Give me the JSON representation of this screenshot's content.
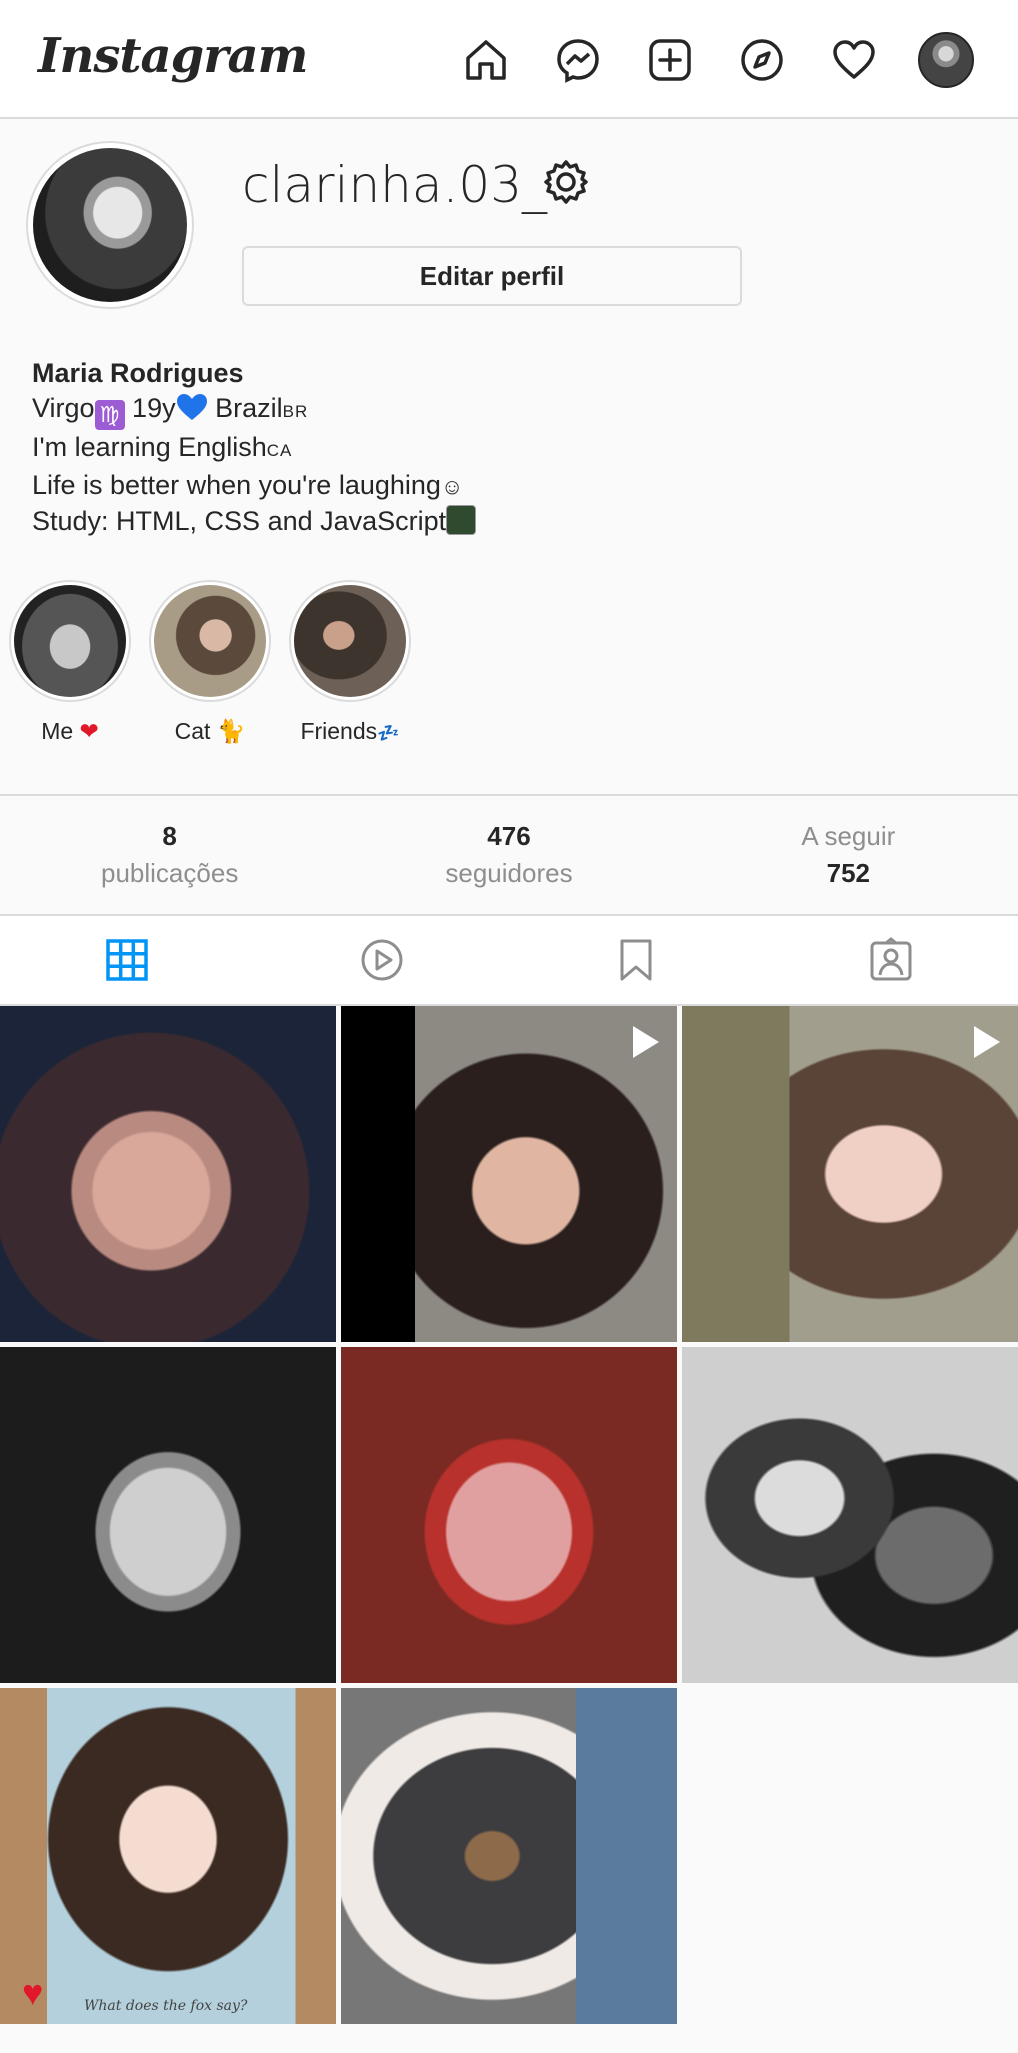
{
  "topbar": {
    "logo": "Instagram",
    "icons": [
      "home-icon",
      "messenger-icon",
      "new-post-icon",
      "explore-icon",
      "activity-heart-icon",
      "profile-avatar"
    ]
  },
  "profile": {
    "username": "clarinha.03_",
    "edit_button": "Editar perfil",
    "name": "Maria Rodrigues",
    "bio_line1_a": "Virgo",
    "virgo_symbol": "♍",
    "bio_line1_b": " 19y",
    "bio_line1_c": " Brazil",
    "bio_line1_flag": "BR",
    "bio_line2": "I'm learning English",
    "bio_line2_flag": "CA",
    "bio_line3": "Life is better when you're laughing",
    "bio_line3_emoji": "☺",
    "bio_line4": "Study: HTML, CSS and JavaScript"
  },
  "highlights": [
    {
      "label": "Me",
      "emoji": "❤"
    },
    {
      "label": "Cat",
      "emoji": "🐈"
    },
    {
      "label": "Friends",
      "emoji": "💤"
    }
  ],
  "stats": {
    "posts_count": "8",
    "posts_label": "publicações",
    "followers_count": "476",
    "followers_label": "seguidores",
    "following_label": "A seguir",
    "following_count": "752"
  },
  "tabs": [
    "posts-grid-tab",
    "reels-tab",
    "saved-tab",
    "tagged-tab"
  ],
  "grid": {
    "caption_text": "What does the fox say?"
  },
  "colors": {
    "accent_blue": "#0095f6",
    "virgo_box": "#9c5cd4",
    "heart_blue": "#1e74e8"
  }
}
